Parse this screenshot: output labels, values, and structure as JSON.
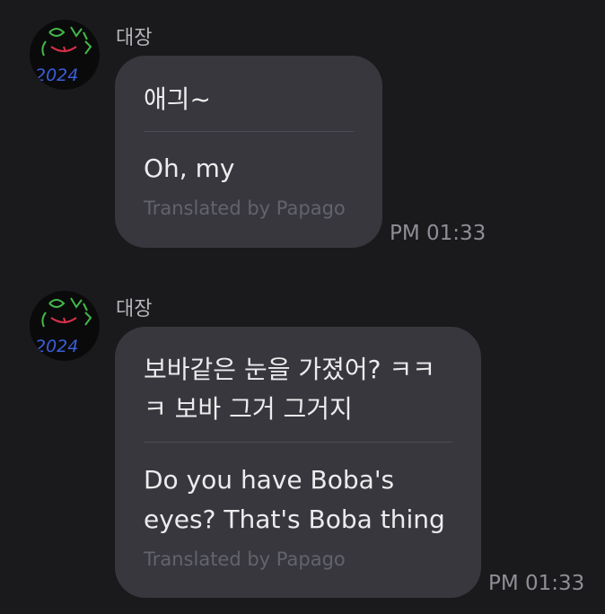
{
  "messages": [
    {
      "sender": "대장",
      "original": "애긔~",
      "translation": "Oh, my",
      "credit": "Translated by Papago",
      "time": "PM 01:33"
    },
    {
      "sender": "대장",
      "original": "보바같은 눈을 가졌어? ㅋㅋㅋ 보바 그거 그거지",
      "translation": "Do you have Boba's eyes? That's Boba thing",
      "credit": "Translated by Papago",
      "time": "PM 01:33"
    }
  ],
  "avatar": {
    "icon": "doodle-face-avatar",
    "text": "2024"
  }
}
